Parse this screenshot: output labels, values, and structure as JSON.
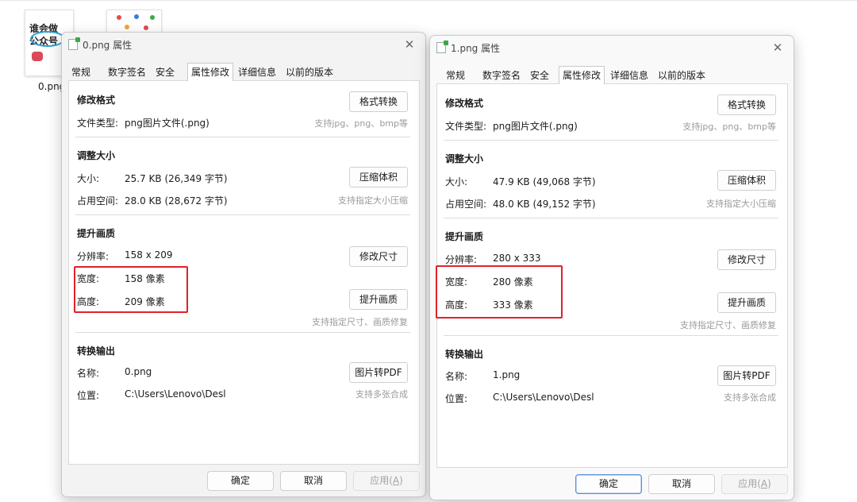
{
  "desktop": {
    "file0_name": "0.png",
    "thumb0_text": [
      "谁会做",
      "公众号"
    ]
  },
  "dialogs": [
    {
      "title": "0.png 属性",
      "tabs": [
        "常规",
        "数字签名",
        "安全",
        "属性修改",
        "详细信息",
        "以前的版本"
      ],
      "active_tab": "属性修改",
      "section_format": "修改格式",
      "btn_format": "格式转换",
      "file_type_label": "文件类型:",
      "file_type_value": "png图片文件(.png)",
      "format_hint": "支持jpg、png、bmp等",
      "section_resize": "调整大小",
      "size_label": "大小:",
      "size_value": "25.7 KB (26,349 字节)",
      "btn_compress": "压缩体积",
      "disk_label": "占用空间:",
      "disk_value": "28.0 KB (28,672 字节)",
      "compress_hint": "支持指定大小压缩",
      "section_quality": "提升画质",
      "res_label": "分辨率:",
      "res_value": "158 x 209",
      "btn_resize": "修改尺寸",
      "width_label": "宽度:",
      "width_value": "158 像素",
      "height_label": "高度:",
      "height_value": "209 像素",
      "btn_enhance": "提升画质",
      "quality_hint": "支持指定尺寸、画质修复",
      "section_convert": "转换输出",
      "name_label": "名称:",
      "name_value": "0.png",
      "btn_pdf": "图片转PDF",
      "loc_label": "位置:",
      "loc_value": "C:\\Users\\Lenovo\\Desl",
      "pdf_hint": "支持多张合成",
      "ok": "确定",
      "cancel": "取消",
      "apply": "应用(",
      "apply_key": "A",
      "apply_end": ")"
    },
    {
      "title": "1.png 属性",
      "tabs": [
        "常规",
        "数字签名",
        "安全",
        "属性修改",
        "详细信息",
        "以前的版本"
      ],
      "active_tab": "属性修改",
      "section_format": "修改格式",
      "btn_format": "格式转换",
      "file_type_label": "文件类型:",
      "file_type_value": "png图片文件(.png)",
      "format_hint": "支持jpg、png、bmp等",
      "section_resize": "调整大小",
      "size_label": "大小:",
      "size_value": "47.9 KB (49,068 字节)",
      "btn_compress": "压缩体积",
      "disk_label": "占用空间:",
      "disk_value": "48.0 KB (49,152 字节)",
      "compress_hint": "支持指定大小压缩",
      "section_quality": "提升画质",
      "res_label": "分辨率:",
      "res_value": "280 x 333",
      "btn_resize": "修改尺寸",
      "width_label": "宽度:",
      "width_value": "280 像素",
      "height_label": "高度:",
      "height_value": "333 像素",
      "btn_enhance": "提升画质",
      "quality_hint": "支持指定尺寸、画质修复",
      "section_convert": "转换输出",
      "name_label": "名称:",
      "name_value": "1.png",
      "btn_pdf": "图片转PDF",
      "loc_label": "位置:",
      "loc_value": "C:\\Users\\Lenovo\\Desl",
      "pdf_hint": "支持多张合成",
      "ok": "确定",
      "cancel": "取消",
      "apply": "应用(",
      "apply_key": "A",
      "apply_end": ")"
    }
  ],
  "colors": {
    "highlight_box": "#e0212b",
    "hint_text": "#9a9a9a",
    "primary_border": "#5c8fd6"
  }
}
